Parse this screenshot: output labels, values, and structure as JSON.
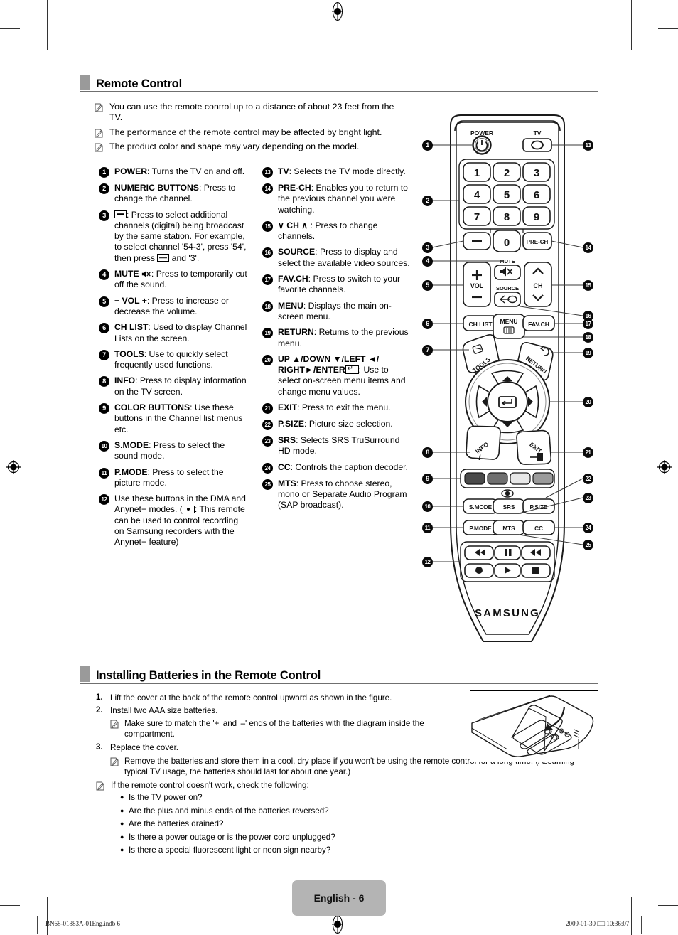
{
  "sections": {
    "remote_control": {
      "title": "Remote Control",
      "notes": [
        "You can use the remote control up to a distance of about 23 feet from the TV.",
        "The performance of the remote control may be affected by bright light.",
        "The product color and shape may vary depending on the model."
      ]
    },
    "batteries": {
      "title": "Installing Batteries in the Remote Control",
      "steps": [
        {
          "n": "1.",
          "text": "Lift the cover at the back of the remote control upward as shown in the figure."
        },
        {
          "n": "2.",
          "text": "Install two AAA size batteries."
        },
        {
          "n": "3.",
          "text": "Replace the cover."
        }
      ],
      "substep_2": "Make sure to match the '+' and '–' ends of the batteries with the diagram inside the compartment.",
      "substep_3": "Remove the batteries and store them in a cool, dry place if you won't be using the remote control for a long time. (Assuming typical TV usage, the batteries should last for about one year.)",
      "check_intro": "If the remote control doesn't work, check the following:",
      "checks": [
        "Is the TV power on?",
        "Are the plus and minus ends of the batteries reversed?",
        "Are the batteries drained?",
        "Is there a power outage  or is the power cord unplugged?",
        "Is there a special fluorescent light or neon sign nearby?"
      ]
    }
  },
  "legend_left": [
    {
      "num": "1",
      "label": "POWER",
      "sep": ": ",
      "text": "Turns the TV on and off."
    },
    {
      "num": "2",
      "label": "NUMERIC BUTTONS",
      "sep": ": ",
      "text": "Press to change the channel."
    },
    {
      "num": "3",
      "label": "",
      "sep": "",
      "text": ": Press to select additional channels (digital) being broadcast by the same station. For example, to select channel '54-3', press '54', then press ",
      "text_tail": " and '3'."
    },
    {
      "num": "4",
      "label": "MUTE",
      "sep": "",
      "text": ": Press to temporarily cut off the sound."
    },
    {
      "num": "5",
      "label": "− VOL +",
      "sep": "",
      "text": ": Press to increase or decrease the volume."
    },
    {
      "num": "6",
      "label": "CH LIST",
      "sep": ": ",
      "text": "Used to display Channel Lists on the screen."
    },
    {
      "num": "7",
      "label": "TOOLS",
      "sep": ": ",
      "text": "Use to quickly select frequently used functions."
    },
    {
      "num": "8",
      "label": "INFO",
      "sep": ": ",
      "text": "Press to display information on the TV screen."
    },
    {
      "num": "9",
      "label": "COLOR BUTTONS",
      "sep": ": ",
      "text": "Use these buttons in the Channel list menus etc."
    },
    {
      "num": "10",
      "label": "S.MODE",
      "sep": ": ",
      "text": "Press to select the sound mode."
    },
    {
      "num": "11",
      "label": "P.MODE",
      "sep": ": ",
      "text": "Press to select the picture mode."
    },
    {
      "num": "12",
      "label": "",
      "sep": "",
      "text": "Use these buttons in the DMA and Anynet+ modes. (",
      "text_tail": ": This remote can be used to control recording on Samsung recorders with the Anynet+ feature)"
    }
  ],
  "legend_right": [
    {
      "num": "13",
      "label": "TV",
      "sep": ": ",
      "text": "Selects the TV mode directly."
    },
    {
      "num": "14",
      "label": "PRE-CH",
      "sep": ": ",
      "text": "Enables you to return to the previous channel you were watching."
    },
    {
      "num": "15",
      "label": "∨ CH ∧",
      "sep": " : ",
      "text": "Press to change channels."
    },
    {
      "num": "16",
      "label": "SOURCE",
      "sep": ": ",
      "text": "Press to display and select the available video sources."
    },
    {
      "num": "17",
      "label": "FAV.CH",
      "sep": ": ",
      "text": "Press to switch to your favorite channels."
    },
    {
      "num": "18",
      "label": "MENU",
      "sep": ": ",
      "text": "Displays the main on-screen menu."
    },
    {
      "num": "19",
      "label": "RETURN",
      "sep": ": ",
      "text": "Returns to the previous menu."
    },
    {
      "num": "20",
      "label": "UP ▲/DOWN ▼/LEFT ◄/ RIGHT►/ENTER",
      "sep": "",
      "text": ": Use to select on-screen menu items and change menu values."
    },
    {
      "num": "21",
      "label": "EXIT",
      "sep": ": ",
      "text": "Press to exit the menu."
    },
    {
      "num": "22",
      "label": "P.SIZE",
      "sep": ": ",
      "text": "Picture size selection."
    },
    {
      "num": "23",
      "label": "SRS",
      "sep": ": ",
      "text": "Selects SRS TruSurround HD mode."
    },
    {
      "num": "24",
      "label": "CC",
      "sep": ": ",
      "text": "Controls the caption decoder."
    },
    {
      "num": "25",
      "label": "MTS",
      "sep": ": ",
      "text": "Press to choose stereo, mono or Separate Audio Program (SAP broadcast)."
    }
  ],
  "remote_figure": {
    "brand": "SAMSUNG",
    "labels": {
      "power": "POWER",
      "tv": "TV",
      "mute": "MUTE",
      "source": "SOURCE",
      "vol": "VOL",
      "ch": "CH",
      "prech": "PRE-CH",
      "chlist": "CH LIST",
      "menu": "MENU",
      "favch": "FAV.CH",
      "tools": "TOOLS",
      "return": "RETURN",
      "info": "INFO",
      "exit": "EXIT",
      "smode": "S.MODE",
      "srs": "SRS",
      "psize": "P.SIZE",
      "pmode": "P.MODE",
      "mts": "MTS",
      "cc": "CC"
    },
    "keypad": [
      "1",
      "2",
      "3",
      "4",
      "5",
      "6",
      "7",
      "8",
      "9",
      "0"
    ],
    "color_buttons": [
      "#4a4a4a",
      "#6f6f6f",
      "#e8e8e8",
      "#9b9b9b"
    ],
    "callouts": [
      "1",
      "2",
      "3",
      "4",
      "5",
      "6",
      "7",
      "8",
      "9",
      "10",
      "11",
      "12",
      "13",
      "14",
      "15",
      "16",
      "17",
      "18",
      "19",
      "20",
      "21",
      "22",
      "23",
      "24",
      "25"
    ]
  },
  "footer": {
    "page_label": "English - 6",
    "file_ref": "BN68-01883A-01Eng.indb   6",
    "timestamp": "2009-01-30   □□ 10:36:07"
  }
}
